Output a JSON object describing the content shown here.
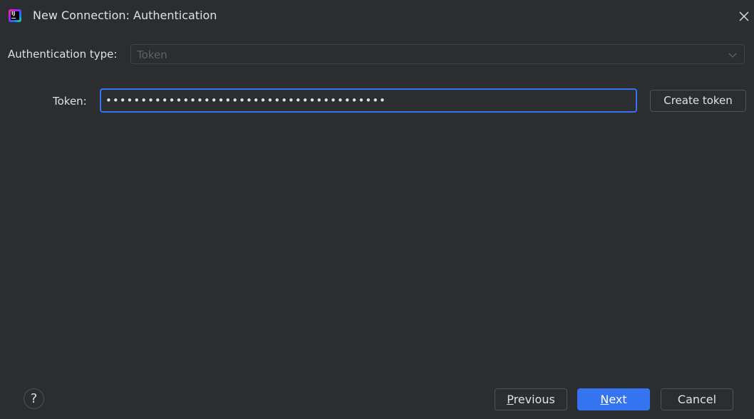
{
  "window": {
    "title": "New Connection: Authentication",
    "app_icon": "intellij-idea-icon",
    "close_icon": "close-icon"
  },
  "auth": {
    "label": "Authentication type:",
    "selected": "Token",
    "dropdown_icon": "chevron-down-icon"
  },
  "token": {
    "label": "Token:",
    "value": "••••••••••••••••••••••••••••••••••••••••",
    "create_label": "Create token"
  },
  "footer": {
    "help_label": "?",
    "previous_mnemonic": "P",
    "previous_rest": "revious",
    "next_mnemonic": "N",
    "next_rest": "ext",
    "cancel_label": "Cancel"
  },
  "colors": {
    "background": "#2b2d30",
    "accent": "#3574f0",
    "text": "#dfe1e5",
    "disabled_text": "#5f6267",
    "border": "#4e5157"
  }
}
